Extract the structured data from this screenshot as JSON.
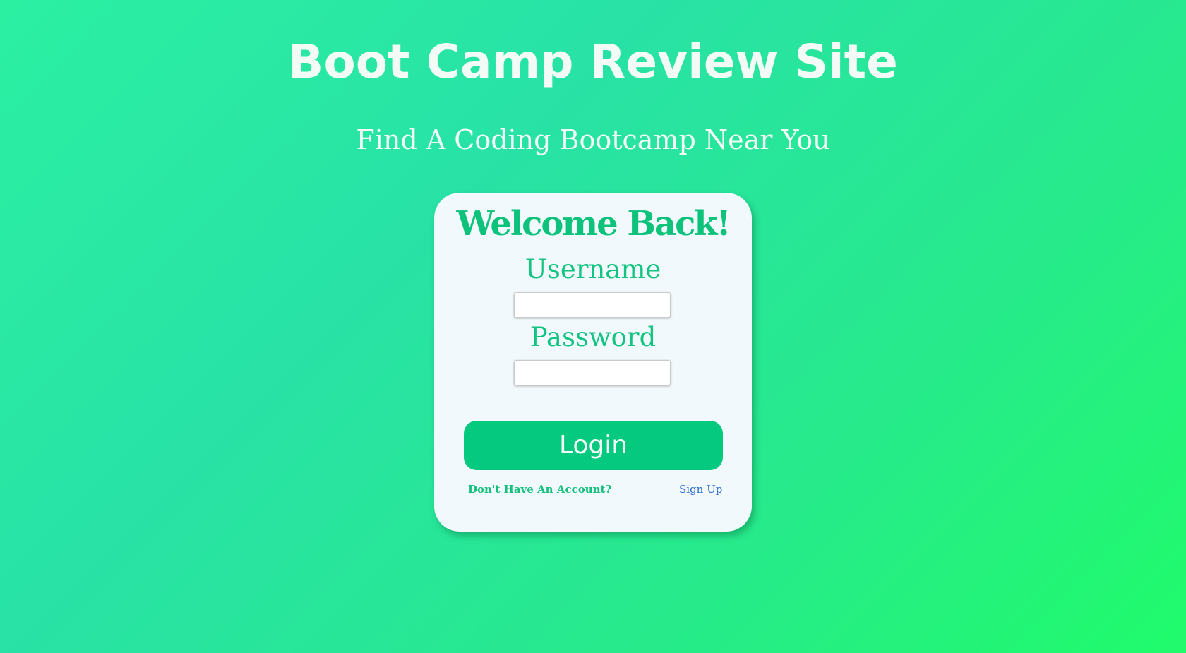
{
  "header": {
    "title": "Boot Camp Review Site",
    "subtitle": "Find A Coding Bootcamp Near You"
  },
  "login_card": {
    "title": "Welcome Back!",
    "username_label": "Username",
    "username_value": "",
    "password_label": "Password",
    "password_value": "",
    "login_button_label": "Login",
    "no_account_text": "Don't Have An Account?",
    "signup_link_label": "Sign Up"
  },
  "colors": {
    "background_start": "#2bf0a2",
    "background_end": "#20fb6b",
    "accent_green": "#05c97f",
    "card_background": "#f2f9fc",
    "link_blue": "#2f6fcf"
  }
}
